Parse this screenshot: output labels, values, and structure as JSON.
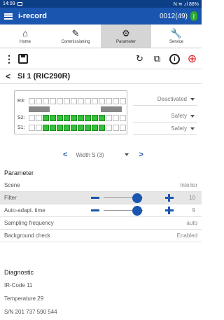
{
  "status": {
    "time": "14:09",
    "icons": "N ≋ .ıl 88%"
  },
  "app": {
    "title": "i-record",
    "device": "0012(49)"
  },
  "tabs": [
    {
      "label": "Home",
      "icon": "home-icon"
    },
    {
      "label": "Commissioning",
      "icon": "edit-icon"
    },
    {
      "label": "Parameter",
      "icon": "gear-icon"
    },
    {
      "label": "Service",
      "icon": "wrench-icon"
    }
  ],
  "section": {
    "title": "SI 1 (RIC290R)"
  },
  "grid": {
    "rows": [
      {
        "label": "R3:",
        "status": "Deactivated"
      },
      {
        "label": "S2:",
        "status": "Safety"
      },
      {
        "label": "S1:",
        "status": "Safety"
      }
    ]
  },
  "width_selector": {
    "value": "Width S (3)"
  },
  "parameter": {
    "title": "Parameter",
    "rows": [
      {
        "label": "Scene",
        "value": "Interior"
      },
      {
        "label": "Filter",
        "value": "10",
        "level": 0.85
      },
      {
        "label": "Auto-adapt. time",
        "value": "9",
        "level": 0.85
      },
      {
        "label": "Sampling frequency",
        "value": "auto"
      },
      {
        "label": "Background check",
        "value": "Enabled"
      }
    ]
  },
  "diagnostic": {
    "title": "Diagnostic",
    "ir_code": "IR-Code  11",
    "temperature": "Temperature  29",
    "sn": "S/N  201 737 590 544"
  },
  "colors": {
    "appbar": "#1a56b0",
    "statusbar": "#0d3f86",
    "active_cell": "#35c23a",
    "accent": "#1a56b0"
  }
}
